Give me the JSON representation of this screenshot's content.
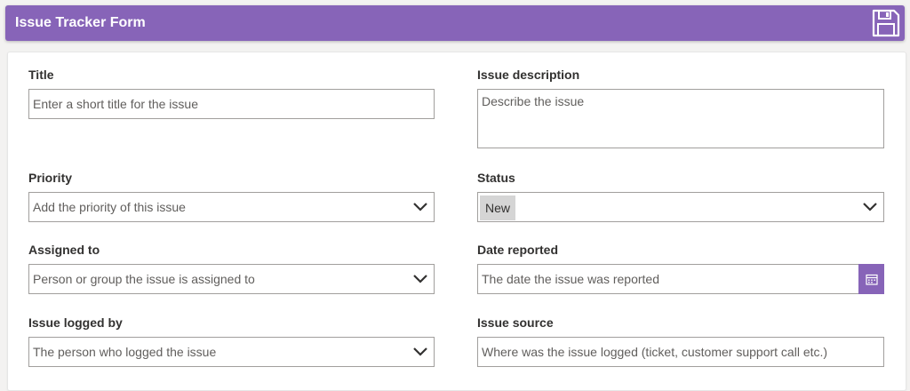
{
  "header": {
    "title": "Issue Tracker Form",
    "save_icon": "save-icon",
    "accent_color": "#8764b8"
  },
  "fields": {
    "title": {
      "label": "Title",
      "placeholder": "Enter a short title for the issue"
    },
    "description": {
      "label": "Issue description",
      "placeholder": "Describe the issue"
    },
    "priority": {
      "label": "Priority",
      "placeholder": "Add the priority of this issue"
    },
    "status": {
      "label": "Status",
      "value": "New"
    },
    "assigned_to": {
      "label": "Assigned to",
      "placeholder": "Person or group the issue is assigned to"
    },
    "date_reported": {
      "label": "Date reported",
      "placeholder": "The date the issue was reported",
      "icon": "calendar-icon"
    },
    "logged_by": {
      "label": "Issue logged by",
      "placeholder": "The person who logged the issue"
    },
    "source": {
      "label": "Issue source",
      "placeholder": "Where was the issue logged (ticket, customer support call etc.)"
    }
  }
}
